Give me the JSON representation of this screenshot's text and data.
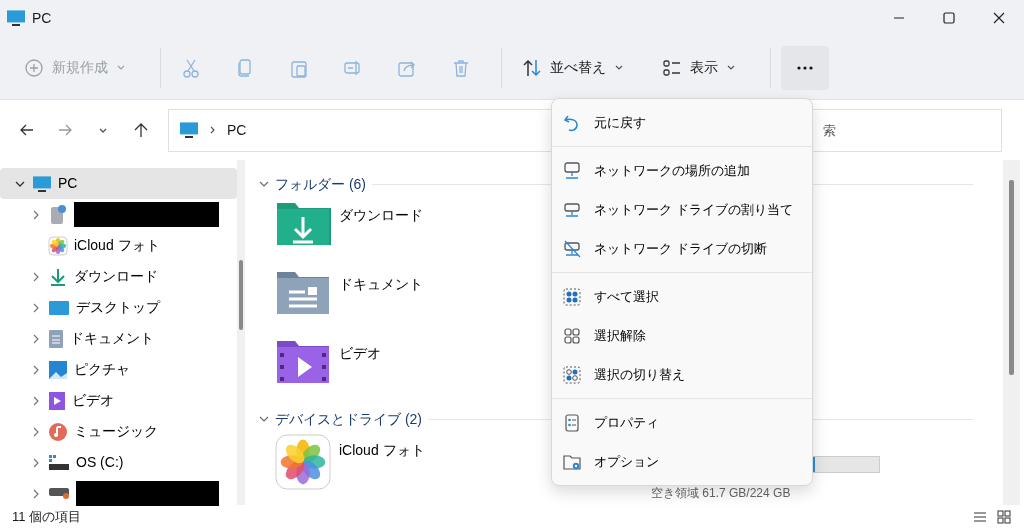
{
  "window": {
    "title": "PC"
  },
  "toolbar": [
    {
      "kind": "new",
      "label": "新規作成",
      "disabled": true
    },
    {
      "kind": "cut",
      "disabled": true
    },
    {
      "kind": "copy",
      "disabled": true
    },
    {
      "kind": "paste",
      "disabled": true
    },
    {
      "kind": "rename",
      "disabled": true
    },
    {
      "kind": "share",
      "disabled": true
    },
    {
      "kind": "delete",
      "disabled": true
    },
    {
      "kind": "sort",
      "label": "並べ替え",
      "disabled": false
    },
    {
      "kind": "view",
      "label": "表示",
      "disabled": false
    },
    {
      "kind": "more",
      "disabled": false,
      "expanded": true
    }
  ],
  "address": {
    "path": "PC",
    "search_placeholder": "索"
  },
  "sidebar": {
    "items": [
      {
        "label": "PC",
        "selected": true,
        "expanded": true,
        "children": [
          {
            "expandable": true,
            "selected": false
          },
          {
            "label": "iCloud フォト",
            "expandable": false,
            "selected": false
          },
          {
            "label": "ダウンロード",
            "expandable": true,
            "selected": false
          },
          {
            "label": "デスクトップ",
            "expandable": true,
            "selected": false
          },
          {
            "label": "ドキュメント",
            "expandable": true,
            "selected": false
          },
          {
            "label": "ピクチャ",
            "expandable": true,
            "selected": false
          },
          {
            "label": "ビデオ",
            "expandable": true,
            "selected": false
          },
          {
            "label": "ミュージック",
            "expandable": true,
            "selected": false
          },
          {
            "label": "OS (C:)",
            "expandable": true,
            "selected": false
          },
          {
            "expandable": true,
            "selected": false
          }
        ]
      }
    ]
  },
  "content": {
    "groups": [
      {
        "label": "フォルダー (6)",
        "expanded": true,
        "items": [
          {
            "name": "ダウンロード"
          },
          {
            "name": "ドキュメント"
          },
          {
            "name": "ビデオ"
          }
        ]
      },
      {
        "label": "デバイスとドライブ (2)",
        "expanded": true,
        "items": [
          {
            "name": "iCloud フォト"
          }
        ],
        "drive": {
          "free": "空き領域 61.7 GB/224 GB",
          "level": 0.72
        }
      }
    ]
  },
  "menu": {
    "sections": [
      [
        {
          "label": "元に戻す"
        }
      ],
      [
        {
          "label": "ネットワークの場所の追加"
        },
        {
          "label": "ネットワーク ドライブの割り当て"
        },
        {
          "label": "ネットワーク ドライブの切断"
        }
      ],
      [
        {
          "label": "すべて選択"
        },
        {
          "label": "選択解除"
        },
        {
          "label": "選択の切り替え"
        }
      ],
      [
        {
          "label": "プロパティ"
        },
        {
          "label": "オプション"
        }
      ]
    ]
  },
  "status_bar": {
    "count": "11 個の項目"
  }
}
